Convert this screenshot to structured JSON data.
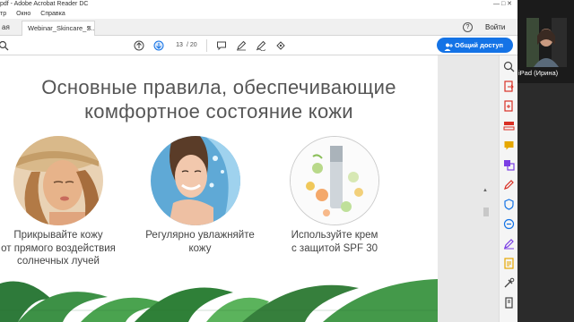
{
  "window": {
    "title": "pdf - Adobe Acrobat Reader DC",
    "controls": "—  □  ✕"
  },
  "menu": {
    "items": [
      "тр",
      "Окно",
      "Справка"
    ]
  },
  "tabs": {
    "home_label": "ая",
    "doc_tab_label": "Webinar_Skincare_S...",
    "close_glyph": "×",
    "help_glyph": "?",
    "login_label": "Войти"
  },
  "toolbar": {
    "page_current": "13",
    "page_total": "/ 20",
    "share_label": "Общий доступ"
  },
  "slide": {
    "title_line1": "Основные правила, обеспечивающие",
    "title_line2": "комфортное состояние кожи",
    "items": [
      {
        "caption_line1": "Прикрывайте кожу",
        "caption_line2": "от прямого воздействия",
        "caption_line3": "солнечных лучей"
      },
      {
        "caption_line1": "Регулярно увлажняйте",
        "caption_line2": "кожу",
        "caption_line3": ""
      },
      {
        "caption_line1": "Используйте крем",
        "caption_line2": "с защитой SPF 30",
        "caption_line3": ""
      }
    ]
  },
  "video": {
    "participant_label": "iPad (Ирина)"
  },
  "colors": {
    "accent": "#1473e6",
    "panel_icon_red": "#d93025",
    "panel_icon_purple": "#7b3fe4",
    "panel_icon_blue": "#1473e6",
    "panel_icon_green": "#2d9d5d",
    "panel_icon_yellow": "#e6a700"
  }
}
